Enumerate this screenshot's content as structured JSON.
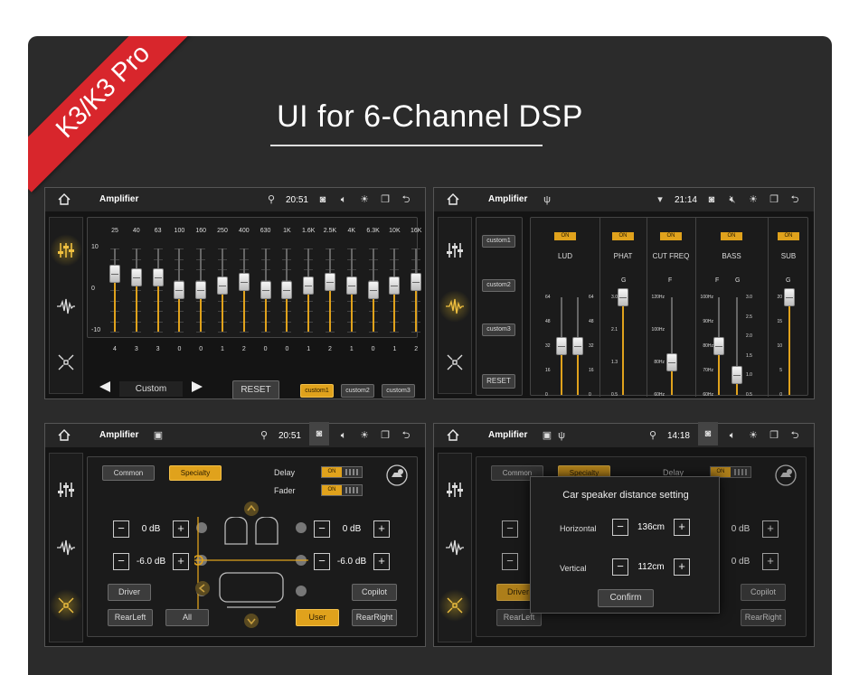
{
  "title": "UI for 6-Channel DSP",
  "badge": "K3/K3 Pro",
  "common": {
    "app_title": "Amplifier"
  },
  "panels": {
    "eq": {
      "time": "20:51",
      "bands": [
        "25",
        "40",
        "63",
        "100",
        "160",
        "250",
        "400",
        "630",
        "1K",
        "1.6K",
        "2.5K",
        "4K",
        "6.3K",
        "10K",
        "16K"
      ],
      "values": [
        4,
        3,
        3,
        0,
        0,
        1,
        2,
        0,
        0,
        1,
        2,
        1,
        0,
        1,
        2
      ],
      "values_text": [
        "4",
        "3",
        "3",
        "0",
        "0",
        "1",
        "2",
        "0",
        "0",
        "1",
        "2",
        "1",
        "0",
        "1",
        "2"
      ],
      "scale": [
        "10",
        "0",
        "-10"
      ],
      "preset_label": "Custom",
      "reset_label": "RESET",
      "customs": [
        "custom1",
        "custom2",
        "custom3"
      ],
      "active_custom": 0
    },
    "dsp": {
      "time": "21:14",
      "customs": [
        "custom1",
        "custom2",
        "custom3"
      ],
      "reset_label": "RESET",
      "on_label": "ON",
      "columns": {
        "lud": {
          "label": "LUD",
          "ticks": [
            "64",
            "48",
            "32",
            "16",
            "0"
          ],
          "values": [
            32,
            32
          ]
        },
        "phat": {
          "label": "PHAT",
          "letter": "G",
          "ticks": [
            "3.0",
            "2.1",
            "1.3",
            "0.5"
          ],
          "value": 3.0
        },
        "cut": {
          "label": "CUT FREQ",
          "letter": "F",
          "ticks": [
            "120Hz",
            "100Hz",
            "80Hz",
            "60Hz"
          ],
          "value": 80
        },
        "bass": {
          "label": "BASS",
          "letters": [
            "F",
            "G"
          ],
          "ticks_left": [
            "100Hz",
            "90Hz",
            "80Hz",
            "70Hz",
            "60Hz"
          ],
          "ticks_right": [
            "3.0",
            "2.5",
            "2.0",
            "1.5",
            "1.0",
            "0.5"
          ],
          "value_f": 80,
          "value_g": 1.0
        },
        "sub": {
          "label": "SUB",
          "letter": "G",
          "ticks": [
            "20",
            "15",
            "10",
            "5",
            "0"
          ],
          "value": 20
        }
      }
    },
    "speaker": {
      "time": "20:51",
      "tabs": [
        "Common",
        "Specialty"
      ],
      "active_tab": 1,
      "delay_label": "Delay",
      "fader_label": "Fader",
      "on_label": "ON",
      "front_left": "0 dB",
      "front_right": "0 dB",
      "rear_left": "-6.0 dB",
      "rear_right": "-6.0 dB",
      "buttons": {
        "driver": "Driver",
        "copilot": "Copilot",
        "rearleft": "RearLeft",
        "all": "All",
        "user": "User",
        "rearright": "RearRight"
      }
    },
    "distance": {
      "time": "14:18",
      "tabs": [
        "Common",
        "Specialty"
      ],
      "delay_label": "Delay",
      "front_right": "0 dB",
      "rear_right": "0 dB",
      "buttons": {
        "driver": "Driver",
        "copilot": "Copilot",
        "rearleft": "RearLeft",
        "rearright": "RearRight"
      },
      "dialog": {
        "title": "Car speaker distance setting",
        "horizontal_label": "Horizontal",
        "horizontal_value": "136cm",
        "vertical_label": "Vertical",
        "vertical_value": "112cm",
        "confirm_label": "Confirm"
      }
    }
  }
}
